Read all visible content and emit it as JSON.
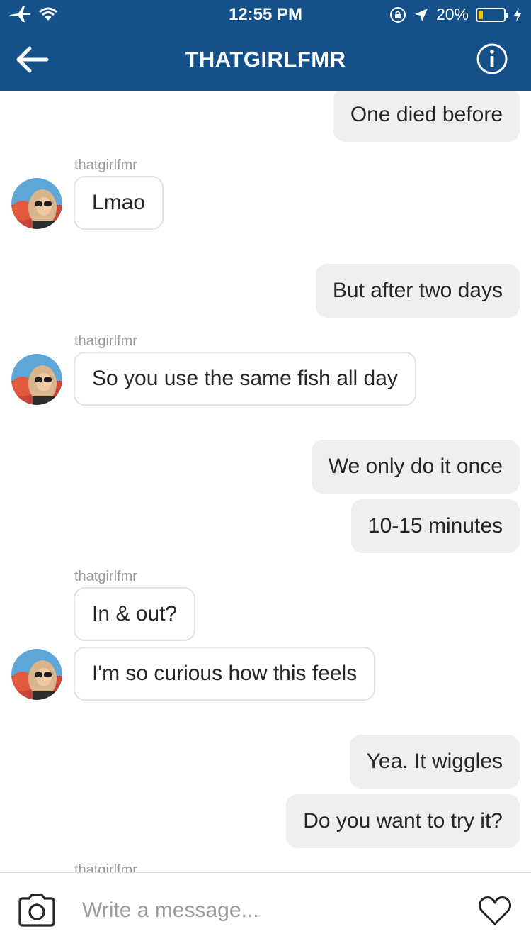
{
  "status_bar": {
    "time": "12:55 PM",
    "battery": "20%",
    "battery_level": 0.2,
    "icons": [
      "airplane-icon",
      "wifi-icon",
      "rotation-lock-icon",
      "location-arrow-icon",
      "battery-icon",
      "charging-bolt-icon"
    ]
  },
  "header": {
    "title": "THATGIRLFMR",
    "back_icon": "back-arrow-icon",
    "info_icon": "info-icon"
  },
  "messages": [
    {
      "direction": "out",
      "text": "One died before"
    },
    {
      "direction": "in",
      "sender": "thatgirlfmr",
      "text": "Lmao"
    },
    {
      "direction": "out",
      "text": "But after two days"
    },
    {
      "direction": "in",
      "sender": "thatgirlfmr",
      "text": "So you use the same fish all day"
    },
    {
      "direction": "out",
      "text": "We only do it once"
    },
    {
      "direction": "out",
      "text": "10-15 minutes"
    },
    {
      "direction": "in",
      "sender": "thatgirlfmr",
      "text": "In & out?"
    },
    {
      "direction": "in",
      "text": "I'm so curious how this feels"
    },
    {
      "direction": "out",
      "text": "Yea. It wiggles"
    },
    {
      "direction": "out",
      "text": "Do you want to try it?"
    },
    {
      "direction": "in",
      "sender": "thatgirlfmr"
    }
  ],
  "composer": {
    "placeholder": "Write a message...",
    "value": "",
    "camera_icon": "camera-icon",
    "heart_icon": "heart-icon"
  },
  "colors": {
    "header_bg": "#14508a",
    "outgoing_bubble": "#efefef",
    "incoming_border": "#e3e3e3",
    "battery_fill": "#f5c400"
  }
}
